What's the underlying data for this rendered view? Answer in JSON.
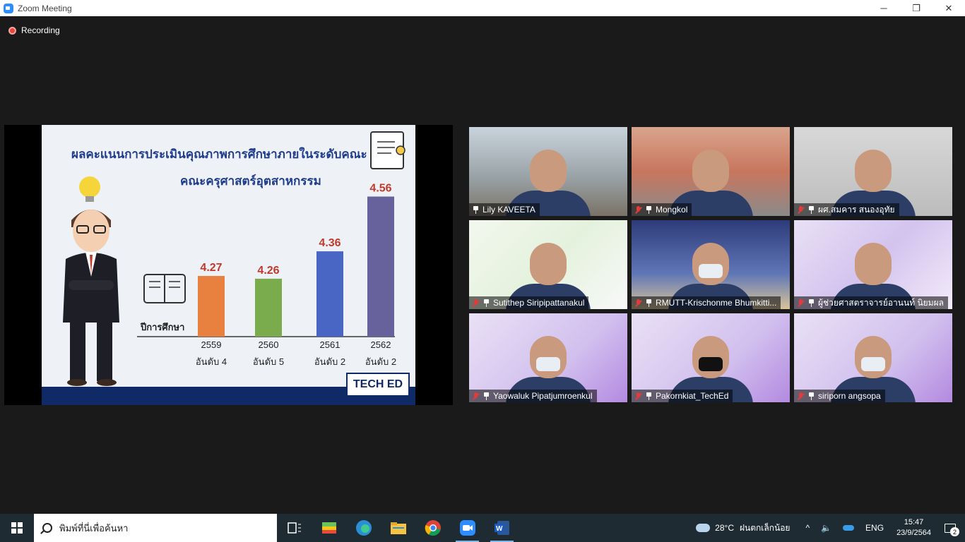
{
  "window": {
    "title": "Zoom Meeting",
    "minimize": "─",
    "restore": "❐",
    "close": "✕"
  },
  "recording": {
    "label": "Recording"
  },
  "slide": {
    "title_line1": "ผลคะแนนการประเมินคุณภาพการศึกษาภายในระดับคณะ",
    "title_line2": "คณะครุศาสตร์อุตสาหกรรม",
    "year_axis_label": "ปีการศึกษา",
    "brand": "TECH ED",
    "colors": {
      "bar1": "#e8813f",
      "bar2": "#7aab4c",
      "bar3": "#4a66c4",
      "bar4": "#67629c",
      "value_text": "#c0392b"
    }
  },
  "chart_data": {
    "type": "bar",
    "categories": [
      "2559",
      "2560",
      "2561",
      "2562"
    ],
    "rank_labels": [
      "อันดับ 4",
      "อันดับ 5",
      "อันดับ 2",
      "อันดับ 2"
    ],
    "values": [
      4.27,
      4.26,
      4.36,
      4.56
    ],
    "value_labels": [
      "4.27",
      "4.26",
      "4.36",
      "4.56"
    ],
    "title": "ผลคะแนนการประเมินคุณภาพการศึกษาภายในระดับคณะ",
    "xlabel": "ปีการศึกษา",
    "ylabel": ""
  },
  "participants": [
    {
      "name": "Lily KAVEETA",
      "muted": false,
      "active": false
    },
    {
      "name": "Mongkol",
      "muted": true,
      "active": false
    },
    {
      "name": "ผศ.สมคาร  สนองอุทัย",
      "muted": true,
      "active": false
    },
    {
      "name": "Sutithep Siripipattanakul",
      "muted": true,
      "active": false
    },
    {
      "name": "RMUTT-Krischonme Bhumkitti...",
      "muted": true,
      "active": false
    },
    {
      "name": "ผู้ช่วยศาสตราจารย์อานนท์ นิยมผล",
      "muted": true,
      "active": false
    },
    {
      "name": "Yaowaluk Pipatjumroenkul",
      "muted": true,
      "active": true
    },
    {
      "name": "Pakornkiat_TechEd",
      "muted": true,
      "active": false
    },
    {
      "name": "siriporn angsopa",
      "muted": true,
      "active": false
    }
  ],
  "taskbar": {
    "search_placeholder": "พิมพ์ที่นี่เพื่อค้นหา",
    "temperature": "28°C",
    "weather": "ฝนตกเล็กน้อย",
    "chevron": "^",
    "volume": "🔈",
    "language": "ENG",
    "time": "15:47",
    "date": "23/9/2564",
    "notification_count": "2"
  }
}
